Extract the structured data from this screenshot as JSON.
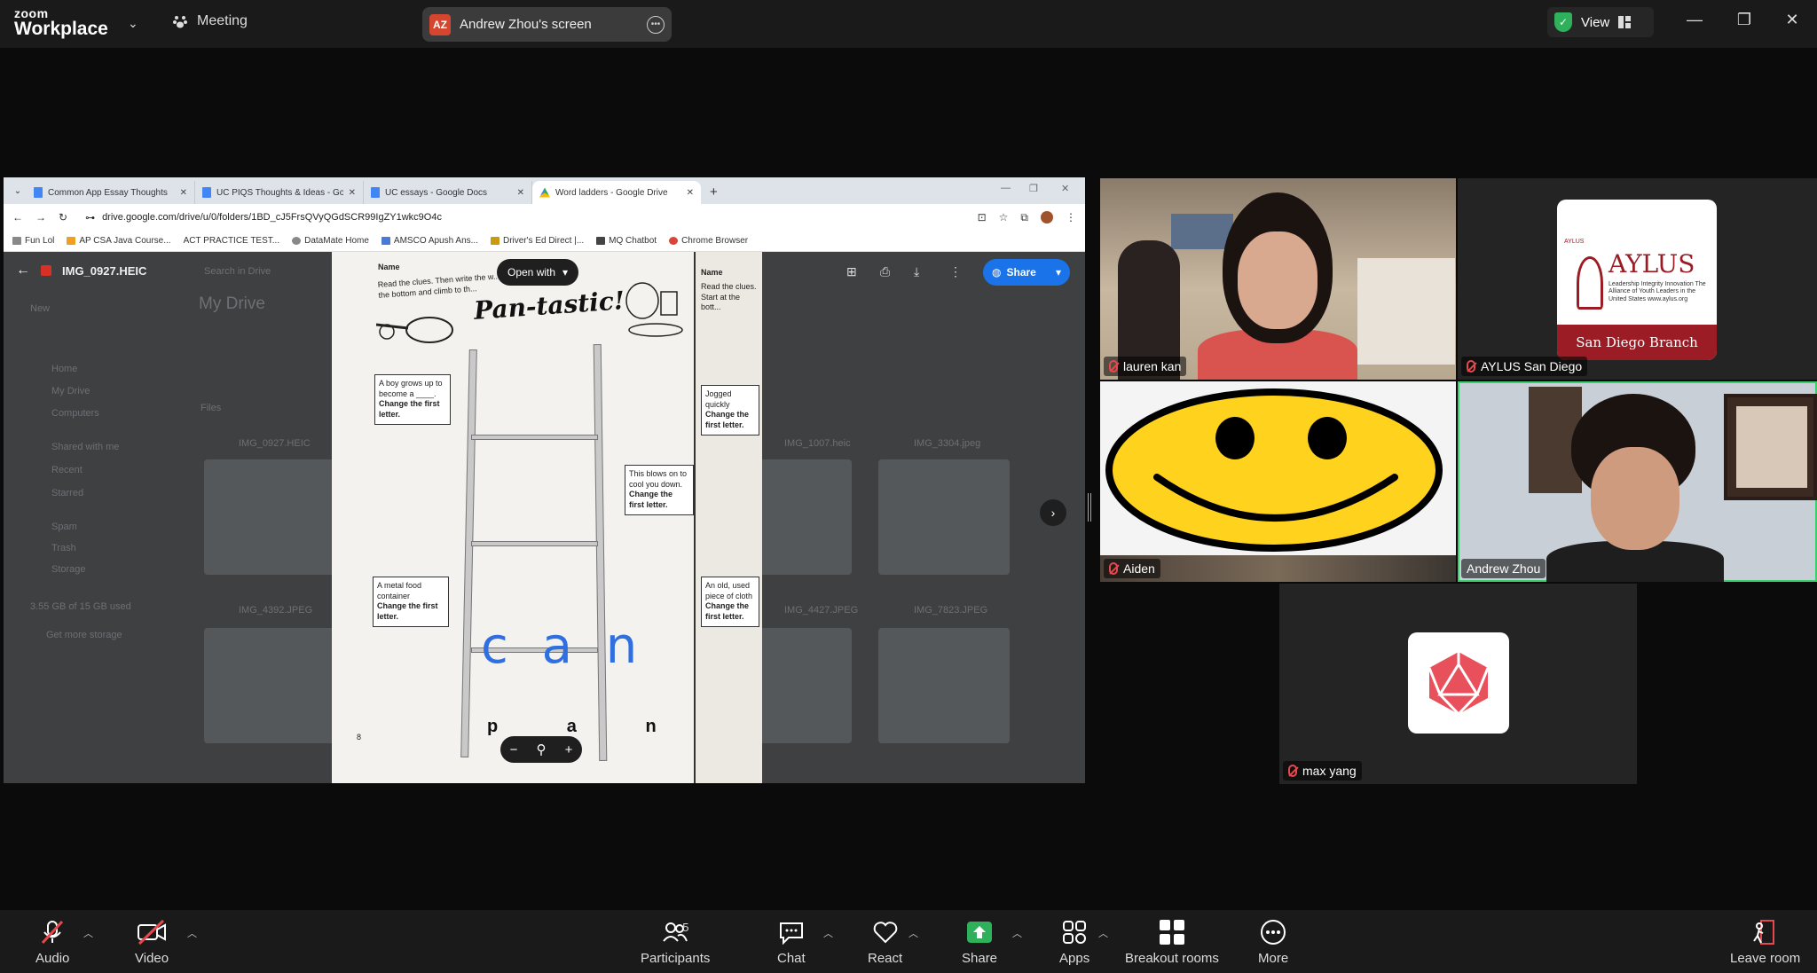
{
  "app": {
    "logo_line1": "zoom",
    "logo_line2": "Workplace",
    "meeting_label": "Meeting",
    "screen_share_initials": "AZ",
    "screen_share_label": "Andrew Zhou's screen",
    "view_label": "View",
    "accent_green": "#2fb05a"
  },
  "browser": {
    "tabs": [
      {
        "label": "Common App Essay Thoughts",
        "icon": "docs-icon"
      },
      {
        "label": "UC PIQS Thoughts & Ideas - Go",
        "icon": "docs-icon"
      },
      {
        "label": "UC essays - Google Docs",
        "icon": "docs-icon"
      },
      {
        "label": "Word ladders - Google Drive",
        "icon": "drive-icon",
        "active": true
      }
    ],
    "url": "drive.google.com/drive/u/0/folders/1BD_cJ5FrsQVyQGdSCR99IgZY1wkc9O4c",
    "bookmarks": [
      "Fun Lol",
      "AP CSA Java Course...",
      "ACT PRACTICE TEST...",
      "DataMate Home",
      "AMSCO Apush Ans...",
      "Driver's Ed Direct |...",
      "MQ Chatbot",
      "Chrome Browser"
    ]
  },
  "drive": {
    "file_name": "IMG_0927.HEIC",
    "open_with": "Open with",
    "share_label": "Share",
    "bg_texts": {
      "search": "Search in Drive",
      "new": "New",
      "my_drive": "My Drive",
      "sidebar": [
        "Home",
        "My Drive",
        "Computers",
        "Shared with me",
        "Recent",
        "Starred",
        "Spam",
        "Trash",
        "Storage"
      ],
      "storage": "3.55 GB of 15 GB used",
      "get_storage": "Get more storage",
      "files_header": "Files",
      "thumb_labels": [
        "IMG_0927.HEIC",
        "IMG_1007.heic",
        "IMG_3304.jpeg",
        "IMG_4392.JPEG",
        "IMG_4427.JPEG",
        "IMG_7823.JPEG"
      ]
    }
  },
  "worksheet": {
    "name_label": "Name",
    "instructions": "Read the clues. Then write the w... Start at the bottom and climb to th...",
    "title": "Pan-tastic!",
    "clue1": "A boy grows up to become a ____.",
    "clue2": "This blows on to cool you down.",
    "clue3": "A metal food container",
    "change_first": "Change the first letter.",
    "handwriting": "c a n",
    "letters": "p a n",
    "page_num": "8",
    "side_clue1": "Jogged quickly",
    "side_clue2": "An old, used piece of cloth",
    "side_name": "Name",
    "side_instr": "Read the clues. Start at the bott..."
  },
  "participants": {
    "tiles": [
      {
        "name": "lauren kan",
        "muted": true
      },
      {
        "name": "AYLUS San Diego",
        "muted": true
      },
      {
        "name": "Aiden",
        "muted": true
      },
      {
        "name": "Andrew Zhou",
        "muted": false,
        "speaking": true
      },
      {
        "name": "max yang",
        "muted": true
      }
    ],
    "aylus_logo": {
      "small": "AYLUS",
      "name": "AYLUS",
      "sub": "Leadership Integrity Innovation The Alliance of Youth Leaders in the United States www.aylus.org",
      "branch": "San Diego Branch"
    }
  },
  "toolbar": {
    "audio": "Audio",
    "video": "Video",
    "participants": "Participants",
    "participant_count": "5",
    "chat": "Chat",
    "react": "React",
    "share": "Share",
    "apps": "Apps",
    "breakout": "Breakout rooms",
    "more": "More",
    "leave": "Leave room"
  }
}
